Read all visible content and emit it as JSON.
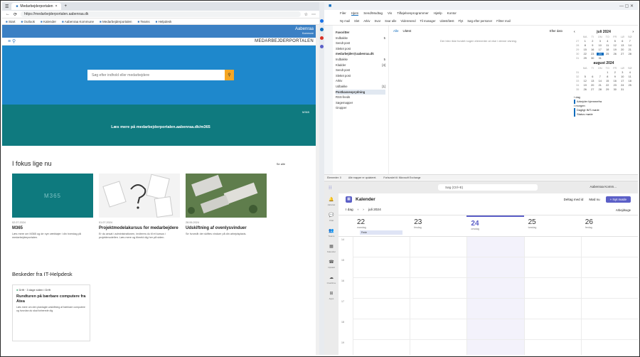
{
  "browser": {
    "tab_title": "Medarbejderportalen",
    "url": "https://medarbejderportalen.aabenraa.dk",
    "bookmarks": [
      "Start",
      "Outlook",
      "Kalender",
      "Aabenraa Kommune",
      "Medarbejderportalen",
      "Teams",
      "Helpdesk"
    ]
  },
  "site": {
    "logo_name": "Aabenraa",
    "logo_sub": "Kommune",
    "portal_title": "MEDARBEJDERPORTALEN",
    "search_placeholder": "Søg efter indhold eller medarbejdere",
    "banner_tag": "M365",
    "banner_link": "Læs mere på medarbejderportalen.aabenraa.dk/m365",
    "fokus_heading": "I fokus lige nu",
    "see_all": "Se alle",
    "cards": [
      {
        "thumb": "M365",
        "date": "02.07.2024",
        "title": "M365",
        "text": "Læs mere om M365 og de nye værktøjer i din hverdag på medarbejderportalen."
      },
      {
        "thumb": "",
        "date": "01.07.2024",
        "title": "Projektmodelakursus for medarbejdere",
        "text": "Er du ansat i administrationen, inviteres du til et kursus i projektmodellen. Læs mere og tilmeld dig her på siden."
      },
      {
        "thumb": "",
        "date": "28.06.2024",
        "title": "Udskiftning af ovenlysvinduer",
        "text": "Se hvornår der skiftes vinduer på din arbejdsplads."
      }
    ],
    "besked_heading": "Beskeder fra IT-Helpdesk",
    "besked": {
      "status": "Drift",
      "meta": "3 dage siden i Drift",
      "title": "Rundturen på bærbare computere fra Atea",
      "text": "Læs mere om den planlagte udskiftning af bærbare computere og hvordan du skal forberede dig."
    }
  },
  "outlook": {
    "menu": [
      "Filer",
      "Hjem",
      "Send/Modtag",
      "Vis",
      "Tilføjelsesprogrammer",
      "Hjælp",
      "Kontor"
    ],
    "active_menu": "Hjem",
    "ribbon": [
      "Ny mail",
      "Slet",
      "Arkiv",
      "Svar",
      "Svar alle",
      "Videresend",
      "Til manager",
      "Ulæst/læst",
      "Flyt",
      "Søg efter personer",
      "Filtrer mail"
    ],
    "folders": [
      {
        "name": "Favoritter",
        "count": "",
        "kind": "hd"
      },
      {
        "name": "Indbakke",
        "count": "5",
        "kind": ""
      },
      {
        "name": "Sendt post",
        "count": "",
        "kind": ""
      },
      {
        "name": "Slettet post",
        "count": "",
        "kind": ""
      },
      {
        "name": "medarbejder@aabenraa.dk",
        "count": "",
        "kind": "hd"
      },
      {
        "name": "Indbakke",
        "count": "5",
        "kind": ""
      },
      {
        "name": "Kladder",
        "count": "[4]",
        "kind": ""
      },
      {
        "name": "Sendt post",
        "count": "",
        "kind": ""
      },
      {
        "name": "Slettet post",
        "count": "",
        "kind": ""
      },
      {
        "name": "Arkiv",
        "count": "",
        "kind": ""
      },
      {
        "name": "Udbakke",
        "count": "[1]",
        "kind": ""
      },
      {
        "name": "Postkasseoprydning",
        "count": "",
        "kind": "sel"
      },
      {
        "name": "RSS-feeds",
        "count": "",
        "kind": ""
      },
      {
        "name": "Søgemapper",
        "count": "",
        "kind": ""
      },
      {
        "name": "Grupper",
        "count": "",
        "kind": ""
      }
    ],
    "list_tabs": [
      "Alle",
      "Ulæst"
    ],
    "list_filter": "Efter dato",
    "list_empty": "Der blev ikke fundet nogen elementer at vise i denne visning.",
    "cal_month1": "juli 2024",
    "cal_month2": "august 2024",
    "weekdays": [
      "",
      "MA",
      "TI",
      "ON",
      "TO",
      "FR",
      "LØ",
      "SØ"
    ],
    "july": [
      [
        "27",
        "1",
        "2",
        "3",
        "4",
        "5",
        "6",
        "7"
      ],
      [
        "28",
        "8",
        "9",
        "10",
        "11",
        "12",
        "13",
        "14"
      ],
      [
        "29",
        "15",
        "16",
        "17",
        "18",
        "19",
        "20",
        "21"
      ],
      [
        "30",
        "22",
        "23",
        "24",
        "25",
        "26",
        "27",
        "28"
      ],
      [
        "31",
        "29",
        "30",
        "31",
        "",
        "",
        "",
        ""
      ]
    ],
    "august": [
      [
        "31",
        "",
        "",
        "",
        "1",
        "2",
        "3",
        "4"
      ],
      [
        "32",
        "5",
        "6",
        "7",
        "8",
        "9",
        "10",
        "11"
      ],
      [
        "33",
        "12",
        "13",
        "14",
        "15",
        "16",
        "17",
        "18"
      ],
      [
        "34",
        "19",
        "20",
        "21",
        "22",
        "23",
        "24",
        "25"
      ],
      [
        "35",
        "26",
        "27",
        "28",
        "29",
        "30",
        "31",
        ""
      ]
    ],
    "today": "24",
    "agenda_today": "I dag",
    "agenda_item1": "Arbejder hjemmefra",
    "agenda_tomorrow": "I morgen",
    "agenda_item2": "Dagligt IMT-møde",
    "agenda_item3": "Status møde",
    "status_items": [
      "Elementer: 0",
      "Alle mapper er opdateret.",
      "Forbundet til: Microsoft Exchange"
    ]
  },
  "teams": {
    "search": "Søg (Ctrl+E)",
    "user": "Aabenraa Komm...",
    "rail": [
      "Aktivitet",
      "Chat",
      "Teams",
      "Kalender",
      "Opkald",
      "OneDrive",
      "Apps"
    ],
    "title": "Kalender",
    "meet_now": "Deltag med id",
    "meet_btn": "Mød nu",
    "new_meeting": "+ Nyt møde",
    "today_btn": "I dag",
    "month_label": "juli 2024",
    "view_label": "Arbejdsuge",
    "days": [
      {
        "num": "22",
        "name": "mandag"
      },
      {
        "num": "23",
        "name": "tirsdag"
      },
      {
        "num": "24",
        "name": "onsdag"
      },
      {
        "num": "25",
        "name": "torsdag"
      },
      {
        "num": "26",
        "name": "fredag"
      }
    ],
    "allday": "Ferie",
    "hours": [
      "14",
      "15",
      "16",
      "17",
      "18",
      "19"
    ]
  }
}
